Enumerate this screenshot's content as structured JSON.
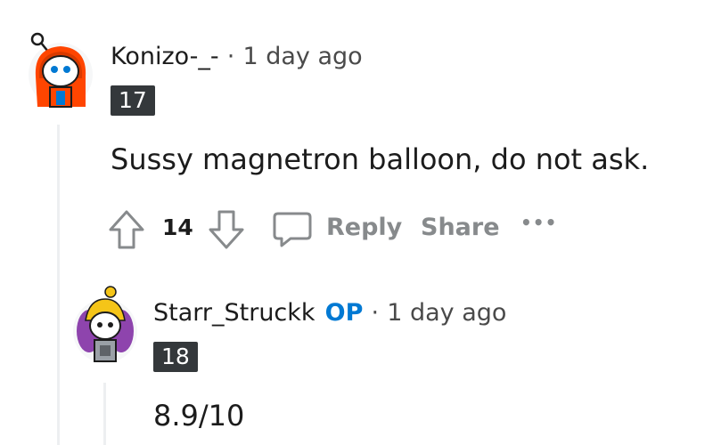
{
  "comments": [
    {
      "username": "Konizo-_-",
      "separator": "·",
      "time": "1 day ago",
      "flair": "17",
      "body": "Sussy magnetron balloon, do not ask.",
      "votes": "14",
      "actions": {
        "reply": "Reply",
        "share": "Share",
        "more": "•••"
      },
      "avatar_icon": "snoo-avatar-orange-hoodie"
    },
    {
      "username": "Starr_Struckk",
      "op_badge": "OP",
      "separator": "·",
      "time": "1 day ago",
      "flair": "18",
      "body": "8.9/10",
      "avatar_icon": "snoo-avatar-purple-hair"
    }
  ],
  "colors": {
    "op_blue": "#0079d3",
    "flair_bg": "#34383b",
    "action_gray": "#878a8c",
    "thread_line": "#edeff1"
  }
}
